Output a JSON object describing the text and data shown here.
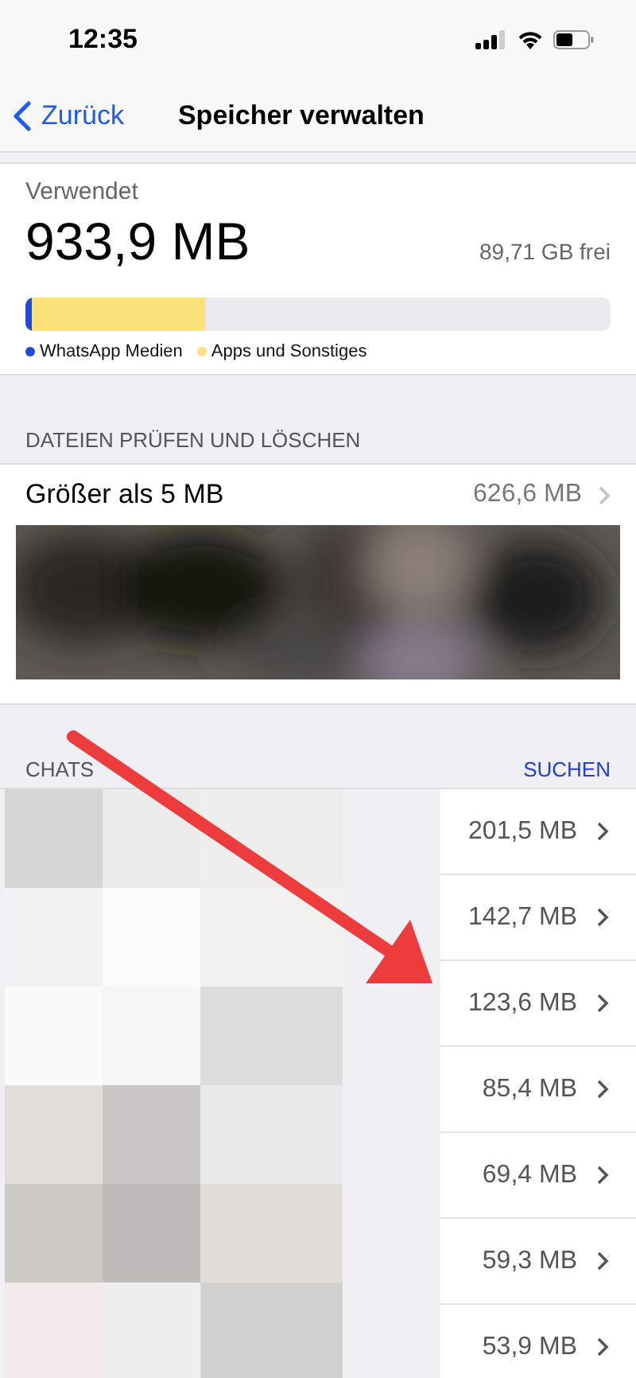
{
  "status_bar": {
    "time": "12:35"
  },
  "nav": {
    "back": "Zurück",
    "title": "Speicher verwalten"
  },
  "storage": {
    "label": "Verwendet",
    "used": "933,9 MB",
    "free": "89,71 GB frei",
    "bar": [
      {
        "color": "#1e4bd8",
        "level": 0.012
      },
      {
        "color": "#fbe17a",
        "level": 0.295
      }
    ],
    "legend": [
      {
        "label": "WhatsApp Medien",
        "color": "#1e4bd8"
      },
      {
        "label": "Apps und Sonstiges",
        "color": "#fbe17a"
      }
    ]
  },
  "review": {
    "header": "DATEIEN PRÜFEN UND LÖSCHEN",
    "row": {
      "label": "Größer als 5 MB",
      "value": "626,6 MB"
    }
  },
  "chats": {
    "header": "CHATS",
    "action": "SUCHEN",
    "rows": [
      {
        "size": "201,5 MB"
      },
      {
        "size": "142,7 MB"
      },
      {
        "size": "123,6 MB"
      },
      {
        "size": "85,4 MB"
      },
      {
        "size": "69,4 MB"
      },
      {
        "size": "59,3 MB"
      },
      {
        "size": "53,9 MB"
      }
    ]
  }
}
